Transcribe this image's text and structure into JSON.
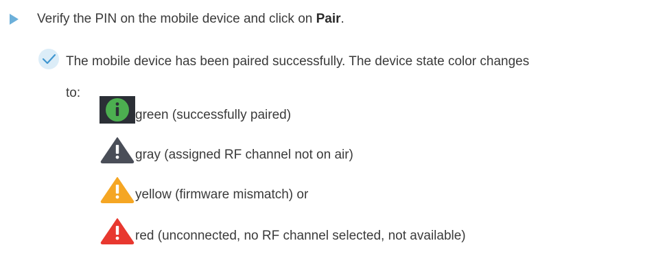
{
  "step": {
    "text_before": "Verify the PIN on the mobile device and click on ",
    "bold": "Pair",
    "text_after": "."
  },
  "result": {
    "line1": "The mobile device has been paired successfully. The device state color changes",
    "line2": "to:"
  },
  "states": [
    {
      "icon": "info-green-icon",
      "color": "#4caf50",
      "label": "green (successfully paired)"
    },
    {
      "icon": "warning-gray-icon",
      "color": "#4a4e58",
      "label": "gray (assigned RF channel not on air)"
    },
    {
      "icon": "warning-yellow-icon",
      "color": "#f5a623",
      "label": "yellow (firmware mismatch) or"
    },
    {
      "icon": "warning-red-icon",
      "color": "#e8382f",
      "label": "red (unconnected, no RF channel selected, not available)"
    }
  ],
  "colors": {
    "step_arrow": "#6cb0da",
    "check_bg": "#dcedf8",
    "check_stroke": "#3f96d0"
  }
}
